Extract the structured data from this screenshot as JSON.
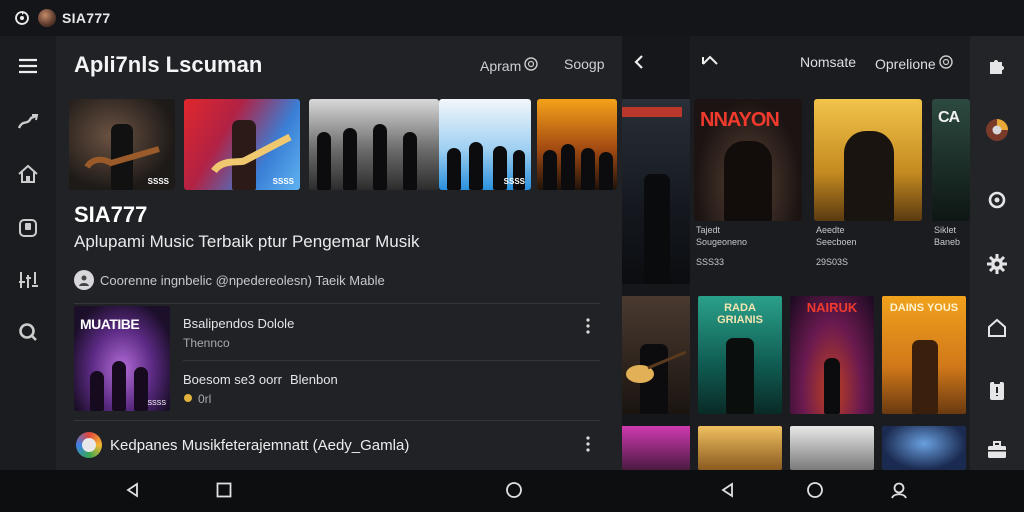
{
  "status_bar": {
    "app_name": "SIA777"
  },
  "main": {
    "title": "Apli7nls Lscuman",
    "header_buttons": [
      "Apram",
      "Soogp"
    ],
    "thumbnails": [
      {
        "tag": "SSSS"
      },
      {
        "tag": "SSSS"
      },
      {
        "tag": ""
      },
      {
        "tag": "SSSS"
      },
      {
        "tag": ""
      }
    ],
    "artist": "SIA777",
    "tagline": "Aplupami Music Terbaik ptur Pengemar Musik",
    "meta_text": "Coorenne ingnbelic @npedereolesn) Taeik Mable",
    "album": {
      "title": "MUATIBE",
      "tag": "SSSS"
    },
    "track_1": {
      "title": "Bsalipendos Dolole",
      "subtitle": "Thennco"
    },
    "track_2": {
      "title": "Boesom se3 oorr",
      "title_b": "Blenbon",
      "rating": "0rl"
    },
    "bottom_item": "Kedpanes Musikfeterajemnatt (Aedy_Gamla)"
  },
  "right": {
    "header_left": "Nomsate",
    "header_right": "Oprelione",
    "cards": [
      {
        "title": "NNAYON",
        "subtitle_line1": "Tajedt",
        "subtitle_line2": "Sougeoneno",
        "count": "SSS33"
      },
      {
        "title": "",
        "subtitle_line1": "Aeedte",
        "subtitle_line2": "Seecboen",
        "count": "29S03S"
      },
      {
        "title": "CA",
        "subtitle_line1": "Siklet",
        "subtitle_line2": "Baneb",
        "count": ""
      }
    ],
    "posters": [
      {
        "title": "RADA GRIANIS"
      },
      {
        "title": "NAIRUK"
      },
      {
        "title": "DAINS YOUS"
      }
    ]
  },
  "colors": {
    "background": "#17191d",
    "panel": "#202226",
    "accent_red": "#f03a2e",
    "accent_gold": "#f0a21c"
  }
}
